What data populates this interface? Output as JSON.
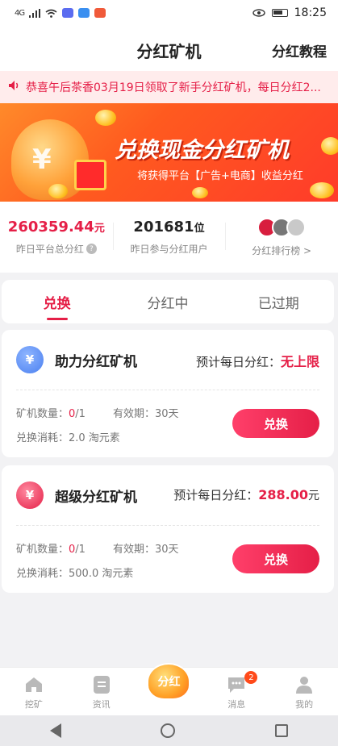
{
  "status_bar": {
    "signal": "4G",
    "time": "18:25"
  },
  "header": {
    "title": "分红矿机",
    "tutorial": "分红教程"
  },
  "marquee": {
    "text": "恭喜午后茶香03月19日领取了新手分红矿机，每日分红2..."
  },
  "banner": {
    "headline": "兑换现金分红矿机",
    "subtitle": "将获得平台【广告+电商】收益分红",
    "symbol": "¥"
  },
  "stats": {
    "total_dividend": {
      "value": "260359.44",
      "unit": "元",
      "label": "昨日平台总分红"
    },
    "participants": {
      "value": "201681",
      "unit": "位",
      "label": "昨日参与分红用户"
    },
    "ranking": {
      "label": "分红排行榜 >"
    }
  },
  "tabs": [
    {
      "label": "兑换",
      "active": true
    },
    {
      "label": "分红中",
      "active": false
    },
    {
      "label": "已过期",
      "active": false
    }
  ],
  "miners": [
    {
      "icon": "¥",
      "name": "助力分红矿机",
      "est_label": "预计每日分红：",
      "est_amount": "无上限",
      "est_unit": "",
      "qty_label": "矿机数量：",
      "qty_owned": "0",
      "qty_total": "/1",
      "validity": "有效期：30天",
      "cost": "兑换消耗：2.0 淘元素",
      "button": "兑换"
    },
    {
      "icon": "¥",
      "name": "超级分红矿机",
      "est_label": "预计每日分红：",
      "est_amount": "288.00",
      "est_unit": "元",
      "qty_label": "矿机数量：",
      "qty_owned": "0",
      "qty_total": "/1",
      "validity": "有效期：30天",
      "cost": "兑换消耗：500.0 淘元素",
      "button": "兑换"
    }
  ],
  "bottom_nav": [
    {
      "label": "挖矿",
      "icon": "home-icon"
    },
    {
      "label": "资讯",
      "icon": "news-icon"
    },
    {
      "label": "分红",
      "icon": "dividend-bag-icon"
    },
    {
      "label": "消息",
      "icon": "message-icon",
      "badge": "2"
    },
    {
      "label": "我的",
      "icon": "profile-icon"
    }
  ],
  "colors": {
    "accent": "#e51f47",
    "banner": "#ff5a1f"
  }
}
